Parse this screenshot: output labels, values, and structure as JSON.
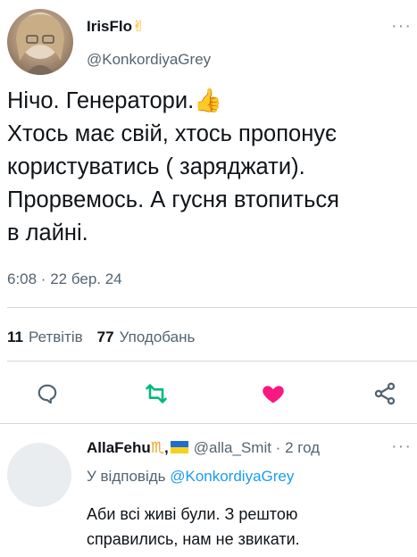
{
  "tweet": {
    "author_name": "IrisFlo",
    "author_emoji": "✌",
    "handle": "@KonkordiyaGrey",
    "more_icon": "more-icon",
    "text_lines": [
      "Нічо. Генератори.",
      "Хтось має свій, хтось пропонує",
      "користуватись ( заряджати).",
      "Прорвемось. А гусня втопиться",
      "в лайні."
    ],
    "thumb_emoji": "👍",
    "time": "6:08 · 22 бер. 24",
    "stats": {
      "retweets_count": "11",
      "retweets_label": "Ретвітів",
      "likes_count": "77",
      "likes_label": "Уподобань"
    },
    "actions": {
      "reply_icon": "comment-icon",
      "retweet_icon": "retweet-icon",
      "like_icon": "heart-icon",
      "share_icon": "share-icon"
    },
    "colors": {
      "retweet": "#00ba7c",
      "like": "#f91880",
      "muted": "#536471",
      "accent": "#1d9bf0"
    }
  },
  "reply": {
    "author_name": "AllaFehu",
    "author_symbol": "♏",
    "handle_and_time": "@alla_Smit · 2 год",
    "reply_to_prefix": "У відповідь ",
    "reply_to_mention": "@KonkordiyaGrey",
    "text": "Аби всі живі були. З рештою справились, нам не звикати."
  }
}
